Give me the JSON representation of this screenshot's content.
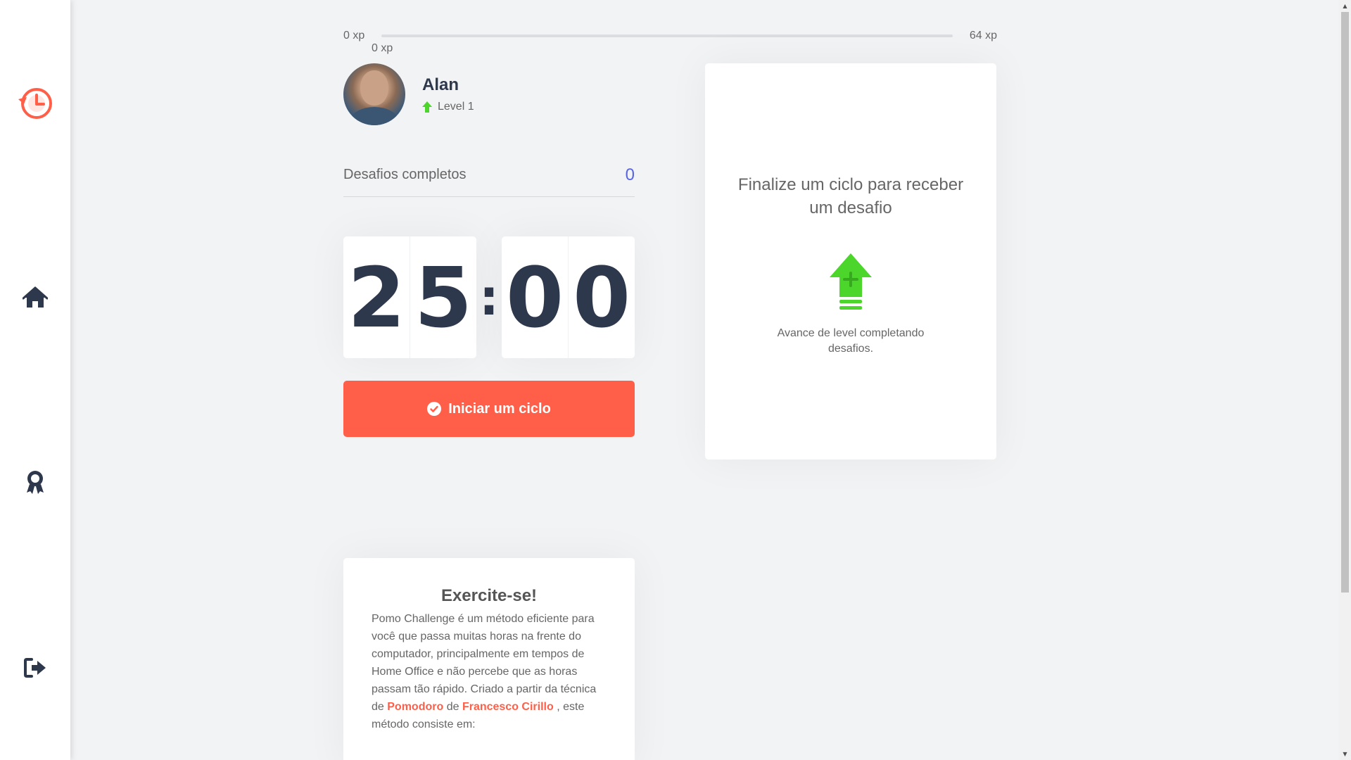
{
  "sidebar": {
    "logo_icon": "history-clock-icon",
    "items": [
      {
        "name": "home",
        "icon": "home-icon"
      },
      {
        "name": "leaderboard",
        "icon": "award-icon"
      },
      {
        "name": "logout",
        "icon": "logout-icon"
      }
    ],
    "accent_color": "#ff5f48",
    "icon_color": "#2e384d"
  },
  "xp": {
    "min_label": "0 xp",
    "max_label": "64 xp",
    "current_label": "0 xp",
    "progress_fraction": 0
  },
  "profile": {
    "name": "Alan",
    "level_label": "Level 1",
    "level_icon": "level-up-arrow-icon"
  },
  "completed": {
    "label": "Desafios completos",
    "count": "0"
  },
  "countdown": {
    "minute_left": "2",
    "minute_right": "5",
    "separator": ":",
    "second_left": "0",
    "second_right": "0"
  },
  "start_button": {
    "label": "Iniciar um ciclo",
    "icon": "check-circle-icon",
    "color": "#ff5f48"
  },
  "challenge": {
    "title": "Finalize um ciclo para receber um desafio",
    "icon": "level-up-icon",
    "hint": "Avance de level completando desafios."
  },
  "exercise": {
    "title": "Exercite-se!",
    "text_part1": "Pomo Challenge é um método eficiente para você que passa muitas horas na frente do computador, principalmente em tempos de Home Office e não percebe que as horas passam tão rápido. Criado a partir da técnica de ",
    "link1": "Pomodoro",
    "text_part2": " de ",
    "link2": "Francesco Cirillo",
    "text_part3": " , este método consiste em:"
  },
  "colors": {
    "background": "#f2f3f5",
    "level_green": "#4cd62b",
    "count_blue": "#5965e0",
    "text": "#666666",
    "title": "#2e384d"
  }
}
